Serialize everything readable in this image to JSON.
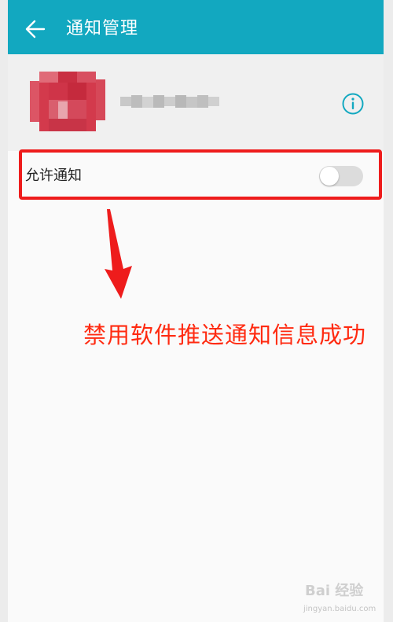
{
  "header": {
    "title": "通知管理",
    "back_icon": "arrow-left-icon"
  },
  "app": {
    "icon": "app-icon-pixelated",
    "info_icon": "info-icon"
  },
  "setting": {
    "label": "允许通知",
    "toggle_on": false
  },
  "annotation": {
    "caption": "禁用软件推送通知信息成功"
  },
  "watermark": {
    "brand": "Bai 经验",
    "url": "jingyan.baidu.com"
  },
  "colors": {
    "title_bar": "#12a8c0",
    "accent": "#12a8c0",
    "annotation_red": "#ee1c1c"
  }
}
